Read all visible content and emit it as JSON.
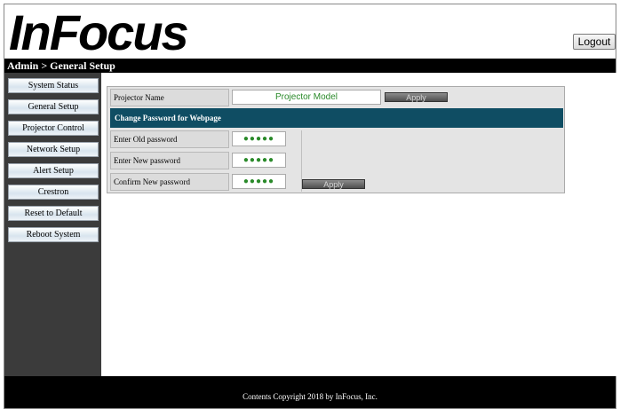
{
  "brand": {
    "logo_text": "InFocus"
  },
  "header": {
    "logout_label": "Logout"
  },
  "breadcrumb": "Admin > General Setup",
  "sidebar": {
    "items": [
      {
        "label": "System Status"
      },
      {
        "label": "General Setup"
      },
      {
        "label": "Projector Control"
      },
      {
        "label": "Network Setup"
      },
      {
        "label": "Alert Setup"
      },
      {
        "label": "Crestron"
      },
      {
        "label": "Reset to Default"
      },
      {
        "label": "Reboot System"
      }
    ]
  },
  "form": {
    "projector_name": {
      "label": "Projector Name",
      "value": "Projector Model",
      "apply_label": "Apply"
    },
    "section_title": "Change Password for Webpage",
    "old_password": {
      "label": "Enter Old password",
      "value": "●●●●●"
    },
    "new_password": {
      "label": "Enter New password",
      "value": "●●●●●"
    },
    "confirm_password": {
      "label": "Confirm New password",
      "value": "●●●●●"
    },
    "password_apply_label": "Apply"
  },
  "footer": {
    "copyright": "Contents Copyright 2018 by InFocus, Inc."
  },
  "colors": {
    "section_bar": "#0f4d63",
    "sidebar_bg": "#3b3b3b",
    "input_text": "#2a8a2a"
  }
}
